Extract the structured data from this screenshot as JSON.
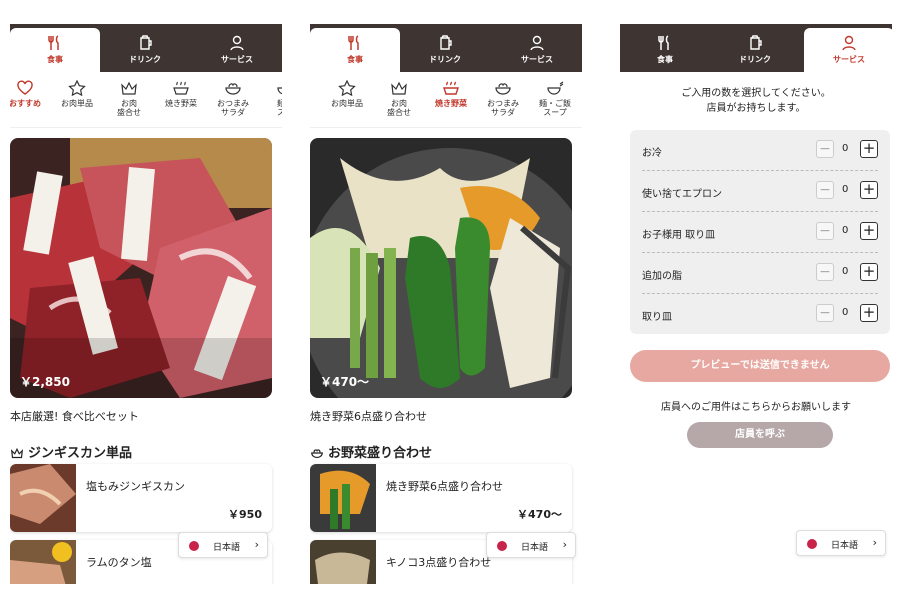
{
  "tabs": {
    "food": "食事",
    "drink": "ドリンク",
    "service": "サービス"
  },
  "categories": {
    "recommend": "おすすめ",
    "meat_single": "お肉単品",
    "meat_combo": [
      "お肉",
      "盛合せ"
    ],
    "grilled_veg": "焼き野菜",
    "snack_salad": [
      "おつまみ",
      "サラダ"
    ],
    "noodles_rice": [
      "麺・ご飯",
      "スープ"
    ],
    "noodles_partial": [
      "麺・",
      "スー"
    ]
  },
  "screen1": {
    "hero_price": "￥2,850",
    "hero_caption": "本店厳選! 食べ比べセット",
    "section_title": "ジンギスカン単品",
    "items": [
      {
        "name": "塩もみジンギスカン",
        "price": "￥950"
      },
      {
        "name": "ラムのタン塩",
        "price": ""
      }
    ]
  },
  "screen2": {
    "hero_price": "￥470〜",
    "hero_caption": "焼き野菜6点盛り合わせ",
    "section_title": "お野菜盛り合わせ",
    "items": [
      {
        "name": "焼き野菜6点盛り合わせ",
        "price": "￥470〜"
      },
      {
        "name": "キノコ3点盛り合わせ",
        "price": ""
      }
    ]
  },
  "service": {
    "intro_line1": "ご入用の数を選択してください。",
    "intro_line2": "店員がお持ちします。",
    "rows": [
      {
        "name": "お冷",
        "qty": "0"
      },
      {
        "name": "使い捨てエプロン",
        "qty": "0"
      },
      {
        "name": "お子様用 取り皿",
        "qty": "0"
      },
      {
        "name": "追加の脂",
        "qty": "0"
      },
      {
        "name": "取り皿",
        "qty": "0"
      }
    ],
    "preview_button": "プレビューでは送信できません",
    "note": "店員へのご用件はこちらからお願いします",
    "call_button": "店員を呼ぶ"
  },
  "language": "日本語",
  "colors": {
    "topbar": "#3e3432",
    "accent": "#c0392b",
    "preview_btn": "#e6a8a0",
    "call_btn": "#b6a7a9"
  }
}
